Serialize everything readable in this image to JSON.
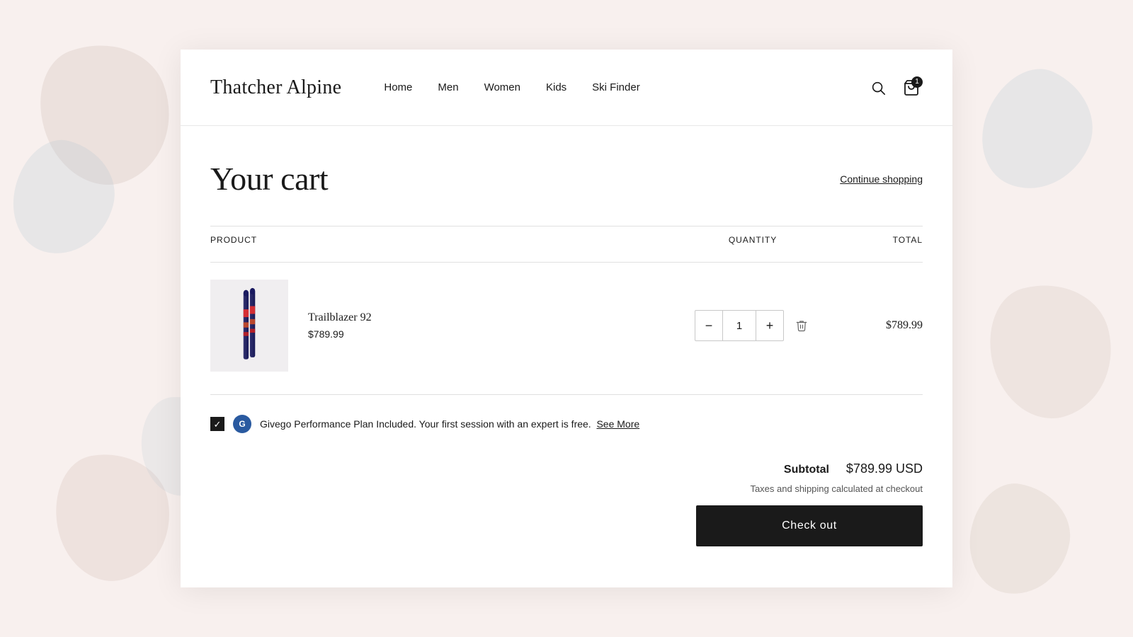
{
  "brand": "Thatcher Alpine",
  "nav": {
    "links": [
      "Home",
      "Men",
      "Women",
      "Kids",
      "Ski Finder"
    ]
  },
  "cart_badge": "1",
  "page": {
    "title": "Your cart",
    "continue_label": "Continue shopping"
  },
  "table": {
    "col_product": "PRODUCT",
    "col_quantity": "QUANTITY",
    "col_total": "TOTAL"
  },
  "item": {
    "name": "Trailblazer 92",
    "price": "$789.99",
    "quantity": "1",
    "total": "$789.99"
  },
  "givego": {
    "text": "Givego Performance Plan Included. Your first session with an expert is free.",
    "link_label": "See More"
  },
  "subtotal": {
    "label": "Subtotal",
    "value": "$789.99 USD",
    "tax_note": "Taxes and shipping calculated at checkout"
  },
  "checkout_label": "Check out"
}
